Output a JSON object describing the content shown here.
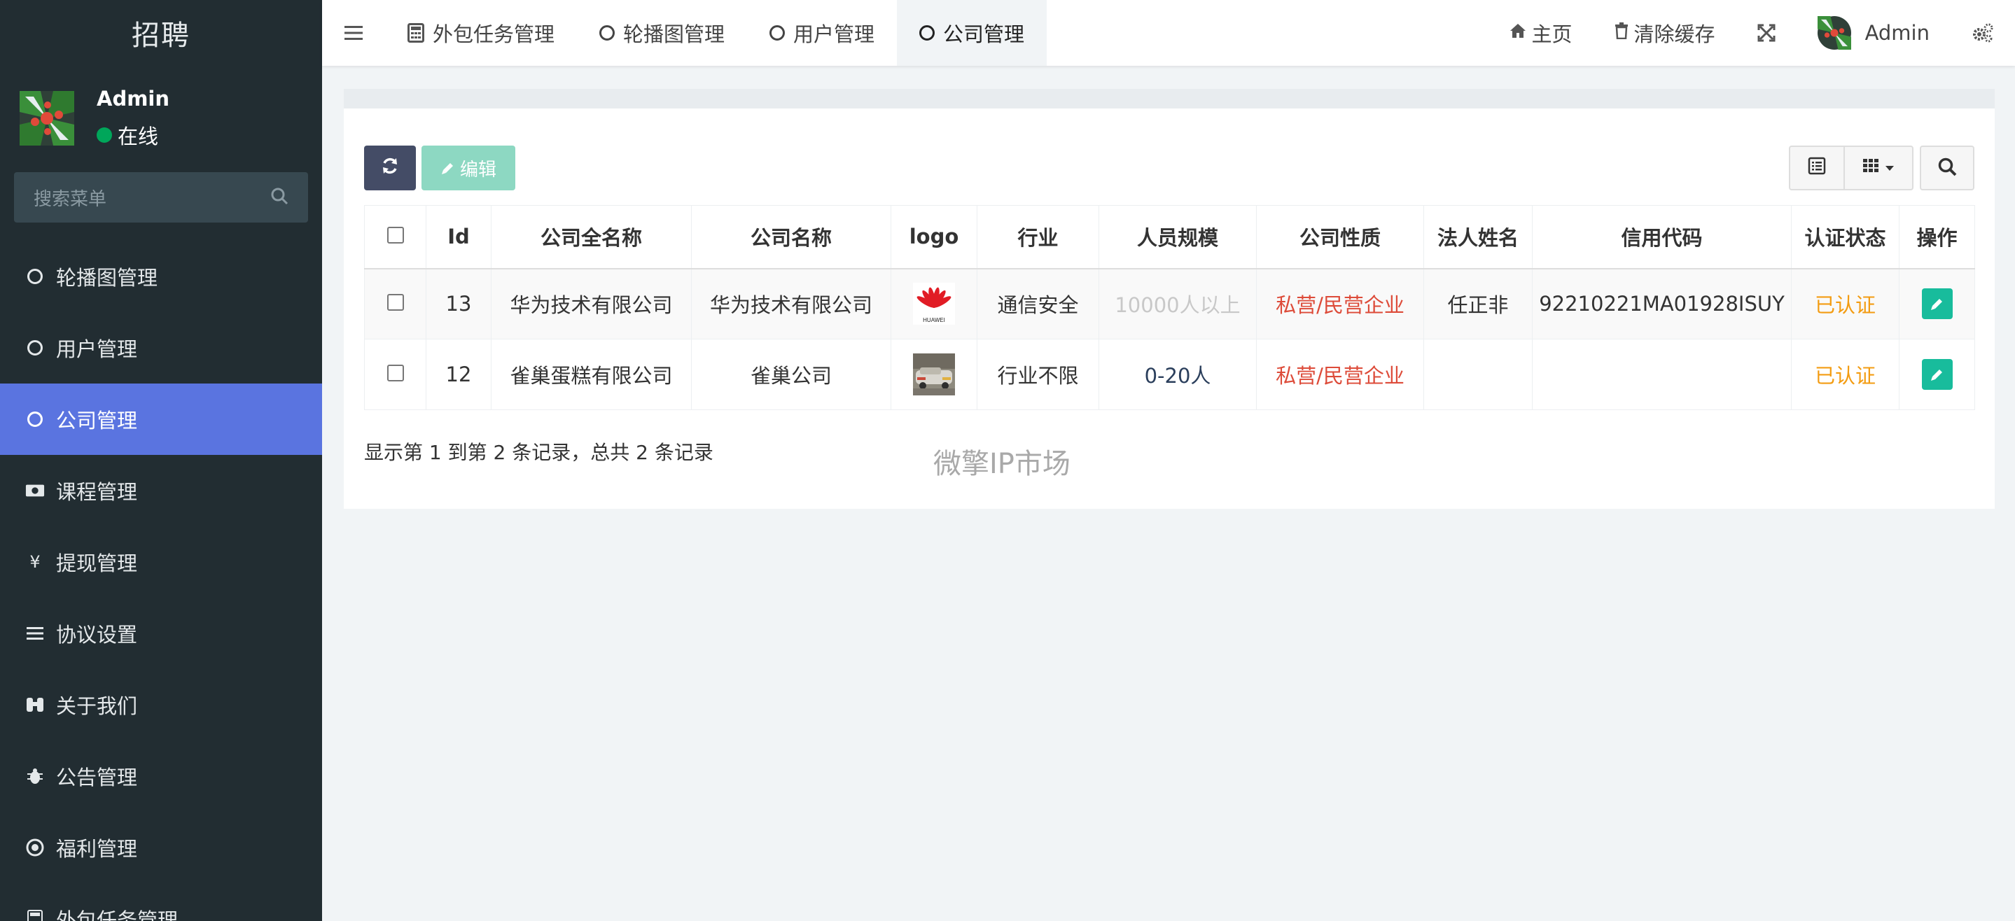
{
  "sidebar": {
    "logo_text": "招聘",
    "user": {
      "name": "Admin",
      "status": "在线"
    },
    "search_placeholder": "搜索菜单",
    "items": [
      {
        "label": "轮播图管理",
        "icon": "circle-icon",
        "active": false
      },
      {
        "label": "用户管理",
        "icon": "circle-icon",
        "active": false
      },
      {
        "label": "公司管理",
        "icon": "circle-icon",
        "active": true
      },
      {
        "label": "课程管理",
        "icon": "money-icon",
        "active": false
      },
      {
        "label": "提现管理",
        "icon": "yen-icon",
        "active": false
      },
      {
        "label": "协议设置",
        "icon": "list-icon",
        "active": false
      },
      {
        "label": "关于我们",
        "icon": "binoculars-icon",
        "active": false
      },
      {
        "label": "公告管理",
        "icon": "bug-icon",
        "active": false
      },
      {
        "label": "福利管理",
        "icon": "chrome-icon",
        "active": false
      },
      {
        "label": "外包任务管理",
        "icon": "calculator-icon",
        "active": false
      }
    ]
  },
  "topbar": {
    "tabs": [
      {
        "label": "外包任务管理",
        "icon": "calculator-icon",
        "active": false
      },
      {
        "label": "轮播图管理",
        "icon": "circle-icon",
        "active": false
      },
      {
        "label": "用户管理",
        "icon": "circle-icon",
        "active": false
      },
      {
        "label": "公司管理",
        "icon": "circle-icon",
        "active": true
      }
    ],
    "home_label": "主页",
    "clear_cache_label": "清除缓存",
    "admin_label": "Admin"
  },
  "toolbar": {
    "edit_label": "编辑"
  },
  "table": {
    "headers": [
      "Id",
      "公司全名称",
      "公司名称",
      "logo",
      "行业",
      "人员规模",
      "公司性质",
      "法人姓名",
      "信用代码",
      "认证状态",
      "操作"
    ],
    "rows": [
      {
        "id": "13",
        "full_name": "华为技术有限公司",
        "name": "华为技术有限公司",
        "logo_text": "HUAWEI",
        "industry": "通信安全",
        "size": "10000人以上",
        "nature": "私营/民营企业",
        "legal": "任正非",
        "credit": "92210221MA01928ISUY",
        "status": "已认证"
      },
      {
        "id": "12",
        "full_name": "雀巢蛋糕有限公司",
        "name": "雀巢公司",
        "logo_text": "",
        "industry": "行业不限",
        "size": "0-20人",
        "nature": "私营/民营企业",
        "legal": "",
        "credit": "",
        "status": "已认证"
      }
    ]
  },
  "summary": "显示第 1 到第 2 条记录，总共 2 条记录",
  "watermark": "微擎IP市场",
  "colors": {
    "sidebar_bg": "#222d32",
    "active_menu": "#5a74e0",
    "refresh_btn": "#444c66",
    "edit_btn": "#8dd8c2",
    "op_btn": "#18bc9c",
    "status_red": "#dd4b39",
    "status_orange": "#f39c12"
  }
}
